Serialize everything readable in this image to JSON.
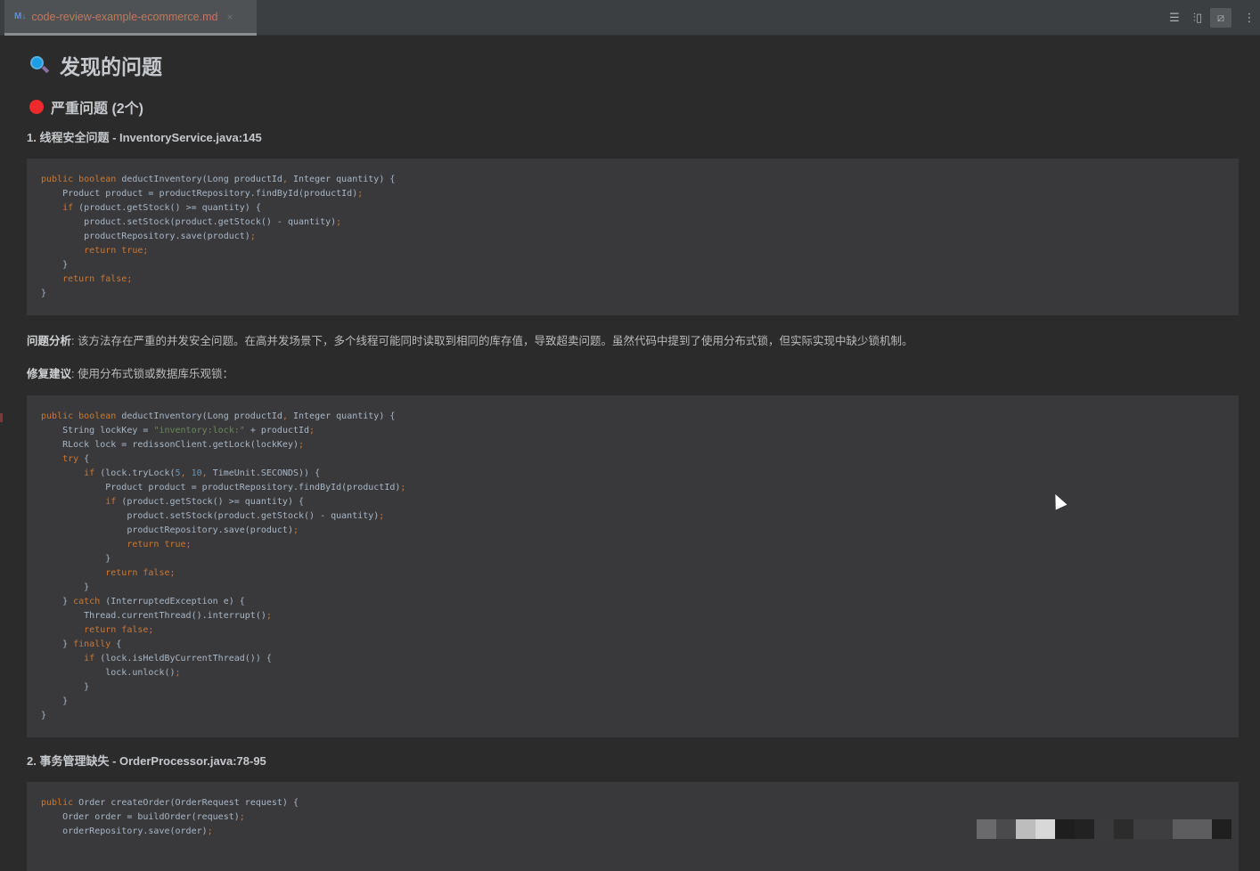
{
  "tab": {
    "icon": "M↓",
    "filename": "code-review-example-ecommerce.md",
    "close": "×"
  },
  "toolbar": {
    "editor_only": "☰",
    "split": "⫶▯",
    "preview": "⧄",
    "more": "⋮"
  },
  "heading": "发现的问题",
  "section": "严重问题 (2个)",
  "issues": [
    {
      "title": "1. 线程安全问题 - InventoryService.java:145"
    },
    {
      "title": "2. 事务管理缺失 - OrderProcessor.java:78-95"
    }
  ],
  "analysis": {
    "label": "问题分析",
    "text": ": 该方法存在严重的并发安全问题。在高并发场景下，多个线程可能同时读取到相同的库存值，导致超卖问题。虽然代码中提到了使用分布式锁，但实际实现中缺少锁机制。"
  },
  "suggestion": {
    "label": "修复建议",
    "text": ": 使用分布式锁或数据库乐观锁："
  },
  "code_blocks": [
    [
      [
        [
          "kw",
          "public boolean "
        ],
        [
          "",
          "deductInventory(Long productId"
        ],
        [
          "kw",
          ", "
        ],
        [
          "",
          "Integer quantity) {"
        ]
      ],
      [
        [
          "",
          "    Product product = productRepository.findById(productId)"
        ],
        [
          "kw",
          ";"
        ]
      ],
      [
        [
          "kw",
          "    if "
        ],
        [
          "",
          "(product.getStock() >= quantity) {"
        ]
      ],
      [
        [
          "",
          "        product.setStock(product.getStock() - quantity)"
        ],
        [
          "kw",
          ";"
        ]
      ],
      [
        [
          "",
          "        productRepository.save(product)"
        ],
        [
          "kw",
          ";"
        ]
      ],
      [
        [
          "kw",
          "        return true;"
        ]
      ],
      [
        [
          "",
          "    }"
        ]
      ],
      [
        [
          "kw",
          "    return false;"
        ]
      ],
      [
        [
          "",
          "}"
        ]
      ]
    ],
    [
      [
        [
          "kw",
          "public boolean "
        ],
        [
          "",
          "deductInventory(Long productId"
        ],
        [
          "kw",
          ", "
        ],
        [
          "",
          "Integer quantity) {"
        ]
      ],
      [
        [
          "",
          "    String lockKey = "
        ],
        [
          "str",
          "\"inventory:lock:\""
        ],
        [
          "",
          " + productId"
        ],
        [
          "kw",
          ";"
        ]
      ],
      [
        [
          "",
          "    RLock lock = redissonClient.getLock(lockKey)"
        ],
        [
          "kw",
          ";"
        ]
      ],
      [
        [
          "kw",
          "    try "
        ],
        [
          "",
          "{"
        ]
      ],
      [
        [
          "kw",
          "        if "
        ],
        [
          "",
          "(lock.tryLock("
        ],
        [
          "num",
          "5"
        ],
        [
          "kw",
          ", "
        ],
        [
          "num",
          "10"
        ],
        [
          "kw",
          ", "
        ],
        [
          "",
          "TimeUnit.SECONDS)) {"
        ]
      ],
      [
        [
          "",
          "            Product product = productRepository.findById(productId)"
        ],
        [
          "kw",
          ";"
        ]
      ],
      [
        [
          "kw",
          "            if "
        ],
        [
          "",
          "(product.getStock() >= quantity) {"
        ]
      ],
      [
        [
          "",
          "                product.setStock(product.getStock() - quantity)"
        ],
        [
          "kw",
          ";"
        ]
      ],
      [
        [
          "",
          "                productRepository.save(product)"
        ],
        [
          "kw",
          ";"
        ]
      ],
      [
        [
          "kw",
          "                return true;"
        ]
      ],
      [
        [
          "",
          "            }"
        ]
      ],
      [
        [
          "kw",
          "            return false;"
        ]
      ],
      [
        [
          "",
          "        }"
        ]
      ],
      [
        [
          "",
          "    } "
        ],
        [
          "kw",
          "catch "
        ],
        [
          "",
          "(InterruptedException e) {"
        ]
      ],
      [
        [
          "",
          "        Thread.currentThread().interrupt()"
        ],
        [
          "kw",
          ";"
        ]
      ],
      [
        [
          "kw",
          "        return false;"
        ]
      ],
      [
        [
          "",
          "    } "
        ],
        [
          "kw",
          "finally "
        ],
        [
          "",
          "{"
        ]
      ],
      [
        [
          "kw",
          "        if "
        ],
        [
          "",
          "(lock.isHeldByCurrentThread()) {"
        ]
      ],
      [
        [
          "",
          "            lock.unlock()"
        ],
        [
          "kw",
          ";"
        ]
      ],
      [
        [
          "",
          "        }"
        ]
      ],
      [
        [
          "",
          "    }"
        ]
      ],
      [
        [
          "",
          "}"
        ]
      ]
    ],
    [
      [
        [
          "kw",
          "public "
        ],
        [
          "",
          "Order createOrder(OrderRequest request) {"
        ]
      ],
      [
        [
          "",
          "    Order order = buildOrder(request)"
        ],
        [
          "kw",
          ";"
        ]
      ],
      [
        [
          "",
          "    orderRepository.save(order)"
        ],
        [
          "kw",
          ";"
        ]
      ]
    ]
  ],
  "mosaic_colors": [
    "#6a6a6c",
    "#4a494b",
    "#bdbdbe",
    "#d8d8d9",
    "#1e1e1f",
    "#222223",
    "#3a3a3c",
    "#2c2c2d",
    "#3e3e40",
    "#3e3e40",
    "#5d5d5f",
    "#5d5d5f",
    "#1e1f1e"
  ]
}
